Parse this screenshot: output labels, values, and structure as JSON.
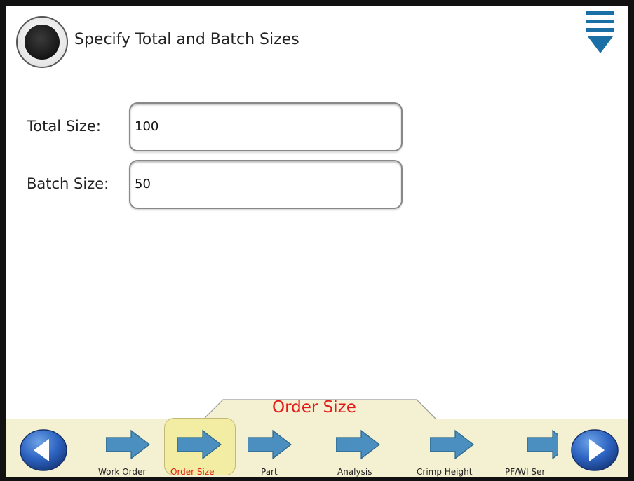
{
  "header": {
    "title": "Specify Total and Batch Sizes",
    "status_icon": "status-indicator-icon",
    "menu_icon": "menu-icon"
  },
  "form": {
    "total_label": "Total Size:",
    "total_value": "100",
    "batch_label": "Batch Size:",
    "batch_value": "50"
  },
  "section": {
    "title": "Order Size"
  },
  "nav": {
    "back_icon": "back-arrow-icon",
    "forward_icon": "forward-arrow-icon",
    "steps": [
      {
        "label": "Work Order",
        "active": false
      },
      {
        "label": "Order Size",
        "active": true
      },
      {
        "label": "Part",
        "active": false
      },
      {
        "label": "Analysis",
        "active": false
      },
      {
        "label": "Crimp Height",
        "active": false
      },
      {
        "label": "PF/WI Ser",
        "active": false
      }
    ]
  },
  "colors": {
    "accent_red": "#e21b1b",
    "nav_bar_bg": "#f4f0d2",
    "arrow_blue": "#4a8fbf",
    "menu_blue": "#1a6fa6",
    "active_step_bg": "#f3eca3"
  }
}
